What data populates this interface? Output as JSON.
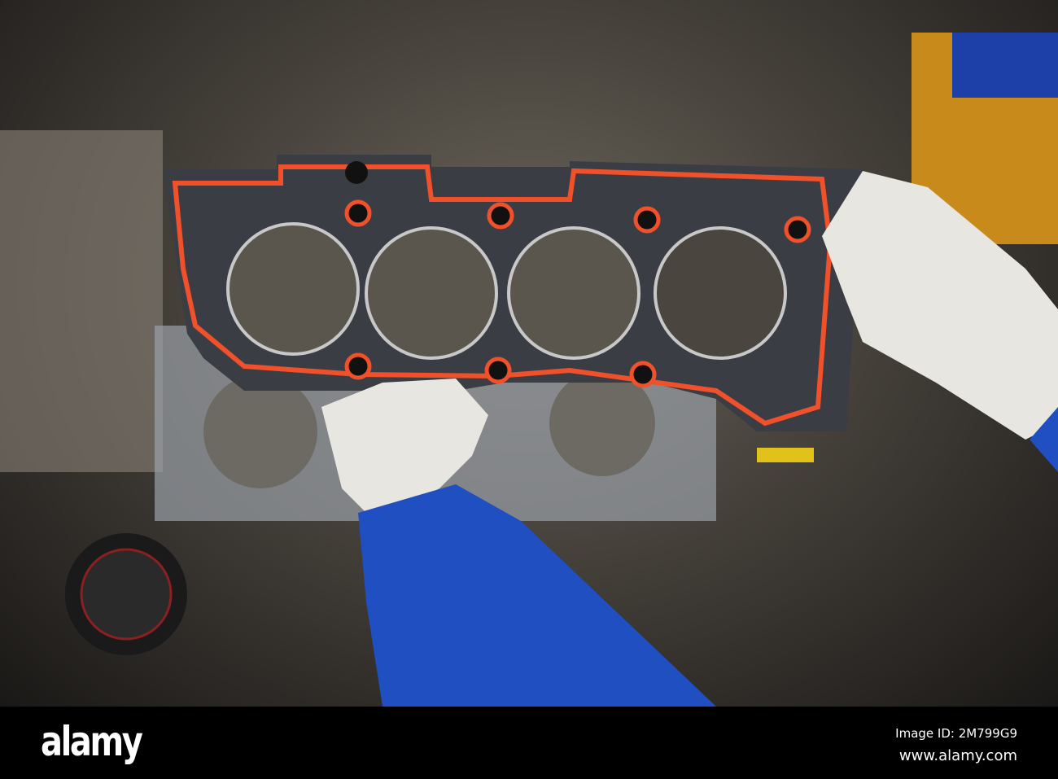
{
  "footer": {
    "logo": "alamy",
    "image_id": "Image ID: 2M799G9",
    "url": "www.alamy.com"
  },
  "colors": {
    "gasket_seal": "#f0502a",
    "gasket_body": "#3a3d44",
    "sleeve": "#1f4fc0",
    "glove": "#e8e6e0"
  }
}
